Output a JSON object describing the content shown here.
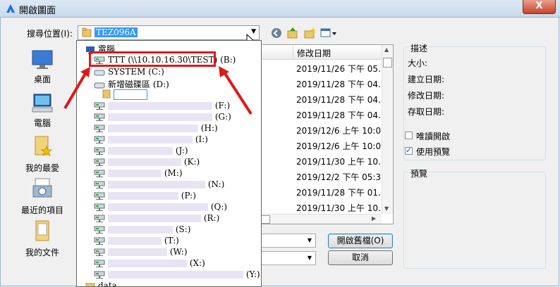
{
  "window": {
    "title": "開啟圖面",
    "close_label": "X"
  },
  "lookin": {
    "label": "搜尋位置(I):",
    "value": "TEZ096A"
  },
  "places": [
    {
      "label": "桌面",
      "icon": "desktop-icon"
    },
    {
      "label": "電腦",
      "icon": "computer-icon"
    },
    {
      "label": "我的最愛",
      "icon": "favorites-folder-icon"
    },
    {
      "label": "最近的項目",
      "icon": "recent-items-icon"
    },
    {
      "label": "我的文件",
      "icon": "documents-folder-icon"
    }
  ],
  "filelist": {
    "column_date": "修改日期",
    "dates": [
      "2019/11/26 下午 05...",
      "2019/11/28 下午 04...",
      "2019/11/28 下午 04...",
      "2019/11/28 下午 04...",
      "2019/12/6 上午 10:09",
      "2019/12/6 上午 10:09",
      "2019/11/30 上午 10...",
      "2019/12/2 下午 05:38",
      "2019/11/28 下午 01...",
      "2019/11/30 上午 10...",
      "2019/11/30 上午 10..."
    ]
  },
  "dropdown": {
    "computer_label": "電腦",
    "network_highlight": "TTT (\\\\10.10.16.30\\TEST) (B:)",
    "system_drive": "SYSTEM (C:)",
    "new_volume": "新增磁碟區 (D:)",
    "drive_letters": [
      "(F:)",
      "(G:)",
      "(H:)",
      "(I:)",
      "(J:)",
      "(K:)",
      "(M:)",
      "(N:)",
      "(P:)",
      "(Q:)",
      "(R:)",
      "(S:)",
      "(T:)",
      "(W:)",
      "(X:)",
      "(Y:)"
    ],
    "last_item": "data"
  },
  "description": {
    "title": "描述",
    "size_label": "大小:",
    "created_label": "建立日期:",
    "modified_label": "修改日期:",
    "accessed_label": "存取日期:"
  },
  "options": {
    "readonly_label": "唯讀開啟",
    "readonly_checked": false,
    "preview_label": "使用預覽",
    "preview_checked": true
  },
  "preview": {
    "title": "預覽"
  },
  "buttons": {
    "open_label": "開啟舊檔(O)",
    "cancel_label": "取消"
  },
  "colors": {
    "highlight": "#e01818",
    "selection": "#3399ff"
  }
}
